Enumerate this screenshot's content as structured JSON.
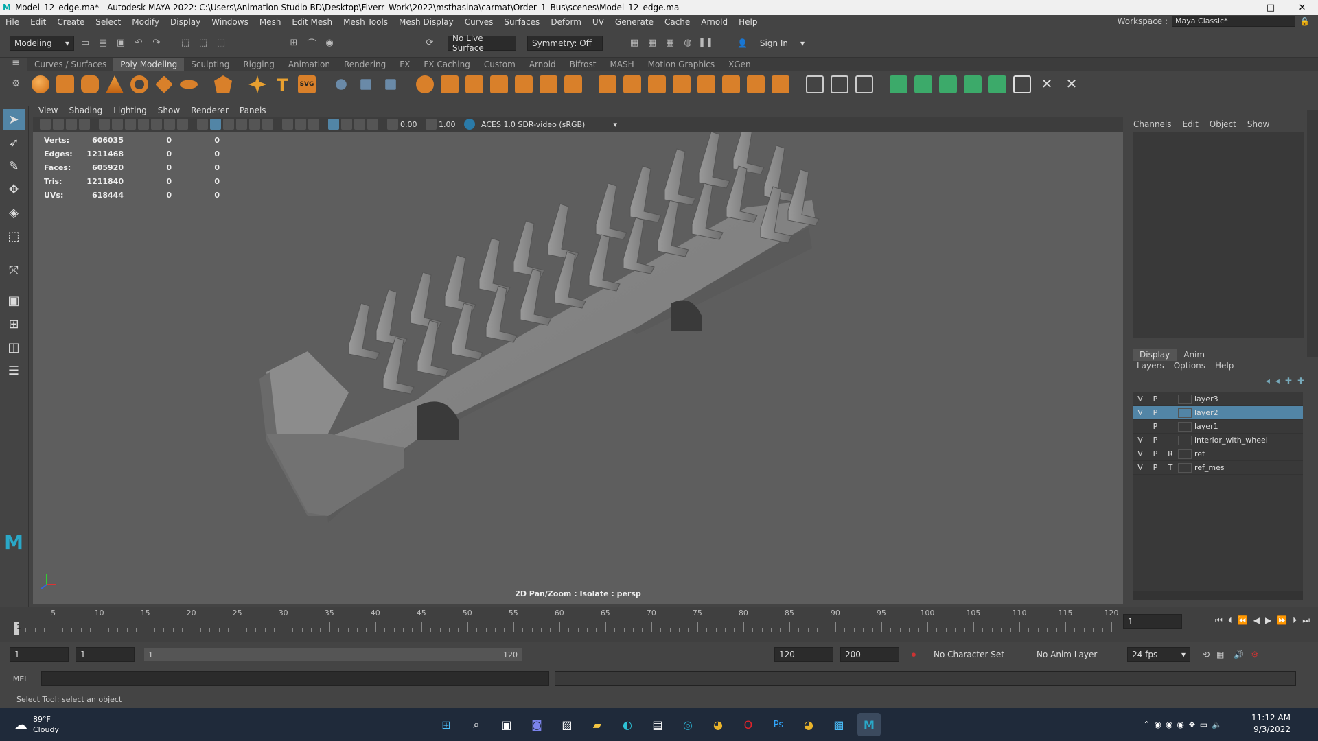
{
  "window": {
    "title": "Model_12_edge.ma* - Autodesk MAYA 2022: C:\\Users\\Animation Studio BD\\Desktop\\Fiverr_Work\\2022\\msthasina\\carmat\\Order_1_Bus\\scenes\\Model_12_edge.ma",
    "minimize": "—",
    "maximize": "□",
    "close": "✕"
  },
  "menubar": {
    "items": [
      "File",
      "Edit",
      "Create",
      "Select",
      "Modify",
      "Display",
      "Windows",
      "Mesh",
      "Edit Mesh",
      "Mesh Tools",
      "Mesh Display",
      "Curves",
      "Surfaces",
      "Deform",
      "UV",
      "Generate",
      "Cache",
      "Arnold",
      "Help"
    ],
    "workspace_label": "Workspace :",
    "workspace_value": "Maya Classic*"
  },
  "statusline": {
    "mode": "Modeling",
    "live_surface": "No Live Surface",
    "symmetry": "Symmetry: Off",
    "sign_in": "Sign In"
  },
  "shelf": {
    "tabs": [
      "Curves / Surfaces",
      "Poly Modeling",
      "Sculpting",
      "Rigging",
      "Animation",
      "Rendering",
      "FX",
      "FX Caching",
      "Custom",
      "Arnold",
      "Bifrost",
      "MASH",
      "Motion Graphics",
      "XGen"
    ],
    "active": "Poly Modeling",
    "text_icon": "T",
    "svg_icon": "SVG"
  },
  "viewport": {
    "menu": [
      "View",
      "Shading",
      "Lighting",
      "Show",
      "Renderer",
      "Panels"
    ],
    "value_a": "0.00",
    "value_b": "1.00",
    "colorspace": "ACES 1.0 SDR-video (sRGB)",
    "stats": [
      {
        "label": "Verts:",
        "v1": "606035",
        "v2": "0",
        "v3": "0"
      },
      {
        "label": "Edges:",
        "v1": "1211468",
        "v2": "0",
        "v3": "0"
      },
      {
        "label": "Faces:",
        "v1": "605920",
        "v2": "0",
        "v3": "0"
      },
      {
        "label": "Tris:",
        "v1": "1211840",
        "v2": "0",
        "v3": "0"
      },
      {
        "label": "UVs:",
        "v1": "618444",
        "v2": "0",
        "v3": "0"
      }
    ],
    "camera_label": "2D Pan/Zoom : Isolate : persp"
  },
  "channelbox": {
    "menu": [
      "Channels",
      "Edit",
      "Object",
      "Show"
    ]
  },
  "layers": {
    "tabs": [
      "Display",
      "Anim"
    ],
    "menu": [
      "Layers",
      "Options",
      "Help"
    ],
    "rows": [
      {
        "v": "V",
        "p": "P",
        "r": "",
        "name": "layer3",
        "selected": false
      },
      {
        "v": "V",
        "p": "P",
        "r": "",
        "name": "layer2",
        "selected": true
      },
      {
        "v": "",
        "p": "P",
        "r": "",
        "name": "layer1",
        "selected": false
      },
      {
        "v": "V",
        "p": "P",
        "r": "",
        "name": "interior_with_wheel",
        "selected": false
      },
      {
        "v": "V",
        "p": "P",
        "r": "R",
        "name": "ref",
        "selected": false
      },
      {
        "v": "V",
        "p": "P",
        "r": "T",
        "name": "ref_mes",
        "selected": false
      }
    ]
  },
  "timeline": {
    "ticks": [
      5,
      10,
      15,
      20,
      25,
      30,
      35,
      40,
      45,
      50,
      55,
      60,
      65,
      70,
      75,
      80,
      85,
      90,
      95,
      100,
      105,
      110,
      115,
      120
    ],
    "current_frame_label": "1",
    "current_frame_field": "1"
  },
  "range": {
    "start": "1",
    "start_inner": "1",
    "slider_start": "1",
    "slider_end": "120",
    "end": "120",
    "end_outer": "200",
    "character_set": "No Character Set",
    "anim_layer": "No Anim Layer",
    "fps": "24 fps"
  },
  "mel": {
    "label": "MEL"
  },
  "helpline": "Select Tool: select an object",
  "taskbar": {
    "weather_temp": "89°F",
    "weather_desc": "Cloudy",
    "time": "11:12 AM",
    "date": "9/3/2022"
  }
}
